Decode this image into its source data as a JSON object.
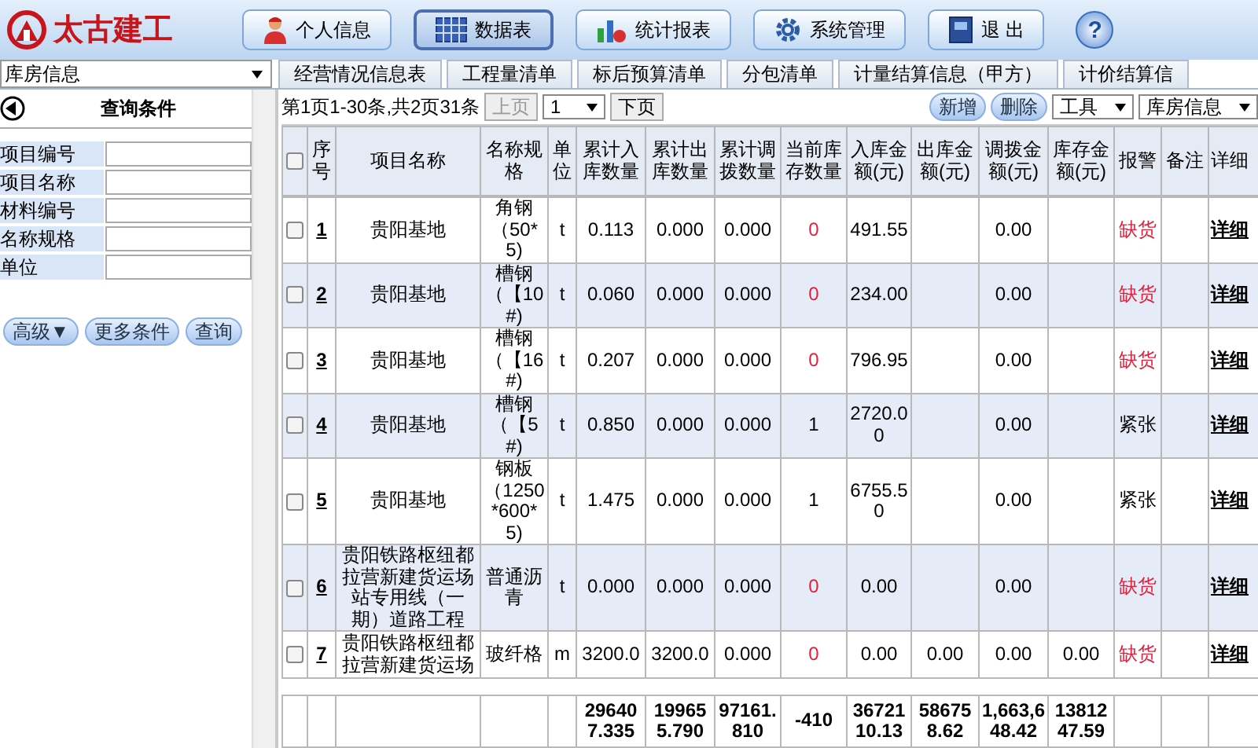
{
  "header": {
    "logo_text": "太古建工",
    "nav": [
      {
        "label": "个人信息",
        "selected": false
      },
      {
        "label": "数据表",
        "selected": true
      },
      {
        "label": "统计报表",
        "selected": false
      },
      {
        "label": "系统管理",
        "selected": false
      },
      {
        "label": "退 出",
        "selected": false
      }
    ],
    "help": "?"
  },
  "warehouse_select": "库房信息",
  "tabs": [
    {
      "label": "经营情况信息表",
      "selected": false
    },
    {
      "label": "工程量清单",
      "selected": false
    },
    {
      "label": "标后预算清单",
      "selected": false
    },
    {
      "label": "分包清单",
      "selected": false
    },
    {
      "label": "计量结算信息（甲方）",
      "selected": false
    },
    {
      "label": "计价结算信",
      "selected": false
    }
  ],
  "query_panel": {
    "title": "查询条件",
    "fields": [
      "项目编号",
      "项目名称",
      "材料编号",
      "名称规格",
      "单位"
    ],
    "buttons": [
      "高级▼",
      "更多条件",
      "查询"
    ]
  },
  "pager": {
    "summary": "第1页1-30条,共2页31条",
    "prev": {
      "label": "上页",
      "disabled": true
    },
    "page": "1",
    "next": {
      "label": "下页",
      "disabled": false
    }
  },
  "actions": [
    "新增",
    "删除"
  ],
  "selects": [
    "工具",
    "库房信息"
  ],
  "table": {
    "header_checked": false,
    "columns": [
      "序号",
      "项目名称",
      "名称规格",
      "单位",
      "累计入库数量",
      "累计出库数量",
      "累计调拨数量",
      "当前库存数量",
      "入库金额(元)",
      "出库金额(元)",
      "调拨金额(元)",
      "库存金额(元)",
      "报警",
      "备注",
      "详细"
    ],
    "rows": [
      {
        "checked": false,
        "no": "1",
        "project": "贵阳基地",
        "spec": "角钢（50*5)",
        "unit": "t",
        "in_qty": "0.113",
        "out_qty": "0.000",
        "transfer_qty": "0.000",
        "stock_qty": "0",
        "in_amount": "491.55",
        "transfer_amount": "0.00",
        "alarm": "缺货",
        "shortage": true,
        "detail": "详细"
      },
      {
        "checked": false,
        "no": "2",
        "project": "贵阳基地",
        "spec": "槽钢（【10#)",
        "unit": "t",
        "in_qty": "0.060",
        "out_qty": "0.000",
        "transfer_qty": "0.000",
        "stock_qty": "0",
        "in_amount": "234.00",
        "transfer_amount": "0.00",
        "alarm": "缺货",
        "shortage": true,
        "detail": "详细"
      },
      {
        "checked": false,
        "no": "3",
        "project": "贵阳基地",
        "spec": "槽钢（【16#)",
        "unit": "t",
        "in_qty": "0.207",
        "out_qty": "0.000",
        "transfer_qty": "0.000",
        "stock_qty": "0",
        "in_amount": "796.95",
        "transfer_amount": "0.00",
        "alarm": "缺货",
        "shortage": true,
        "detail": "详细"
      },
      {
        "checked": false,
        "no": "4",
        "project": "贵阳基地",
        "spec": "槽钢（【5#)",
        "unit": "t",
        "in_qty": "0.850",
        "out_qty": "0.000",
        "transfer_qty": "0.000",
        "stock_qty": "1",
        "in_amount": "2720.00",
        "transfer_amount": "0.00",
        "alarm": "紧张",
        "shortage": false,
        "detail": "详细"
      },
      {
        "checked": false,
        "no": "5",
        "project": "贵阳基地",
        "spec": "钢板（1250*600*5)",
        "unit": "t",
        "in_qty": "1.475",
        "out_qty": "0.000",
        "transfer_qty": "0.000",
        "stock_qty": "1",
        "in_amount": "6755.50",
        "transfer_amount": "0.00",
        "alarm": "紧张",
        "shortage": false,
        "detail": "详细"
      },
      {
        "checked": false,
        "no": "6",
        "project": "贵阳铁路枢纽都拉营新建货运场站专用线（一期）道路工程",
        "spec": "普通沥青",
        "unit": "t",
        "in_qty": "0.000",
        "out_qty": "0.000",
        "transfer_qty": "0.000",
        "stock_qty": "0",
        "in_amount": "0.00",
        "transfer_amount": "0.00",
        "alarm": "缺货",
        "shortage": true,
        "detail": "详细"
      },
      {
        "checked": false,
        "no": "7",
        "project": "贵阳铁路枢纽都拉营新建货运场",
        "spec": "玻纤格",
        "unit": "m",
        "in_qty": "3200.0",
        "out_qty": "3200.0",
        "transfer_qty": "0.000",
        "stock_qty": "0",
        "in_amount": "0.00",
        "out_amount": "0.00",
        "transfer_amount": "0.00",
        "stock_amount": "0.00",
        "alarm": "缺货",
        "shortage": true,
        "detail": "详细"
      }
    ],
    "totals": {
      "in_qty": "296407.335",
      "out_qty": "199655.790",
      "transfer_qty": "97161.810",
      "stock_qty": "-410",
      "in_amount": "3672110.13",
      "out_amount": "586758.62",
      "transfer_amount": "1,663,648.42",
      "stock_amount": "1381247.59"
    }
  }
}
